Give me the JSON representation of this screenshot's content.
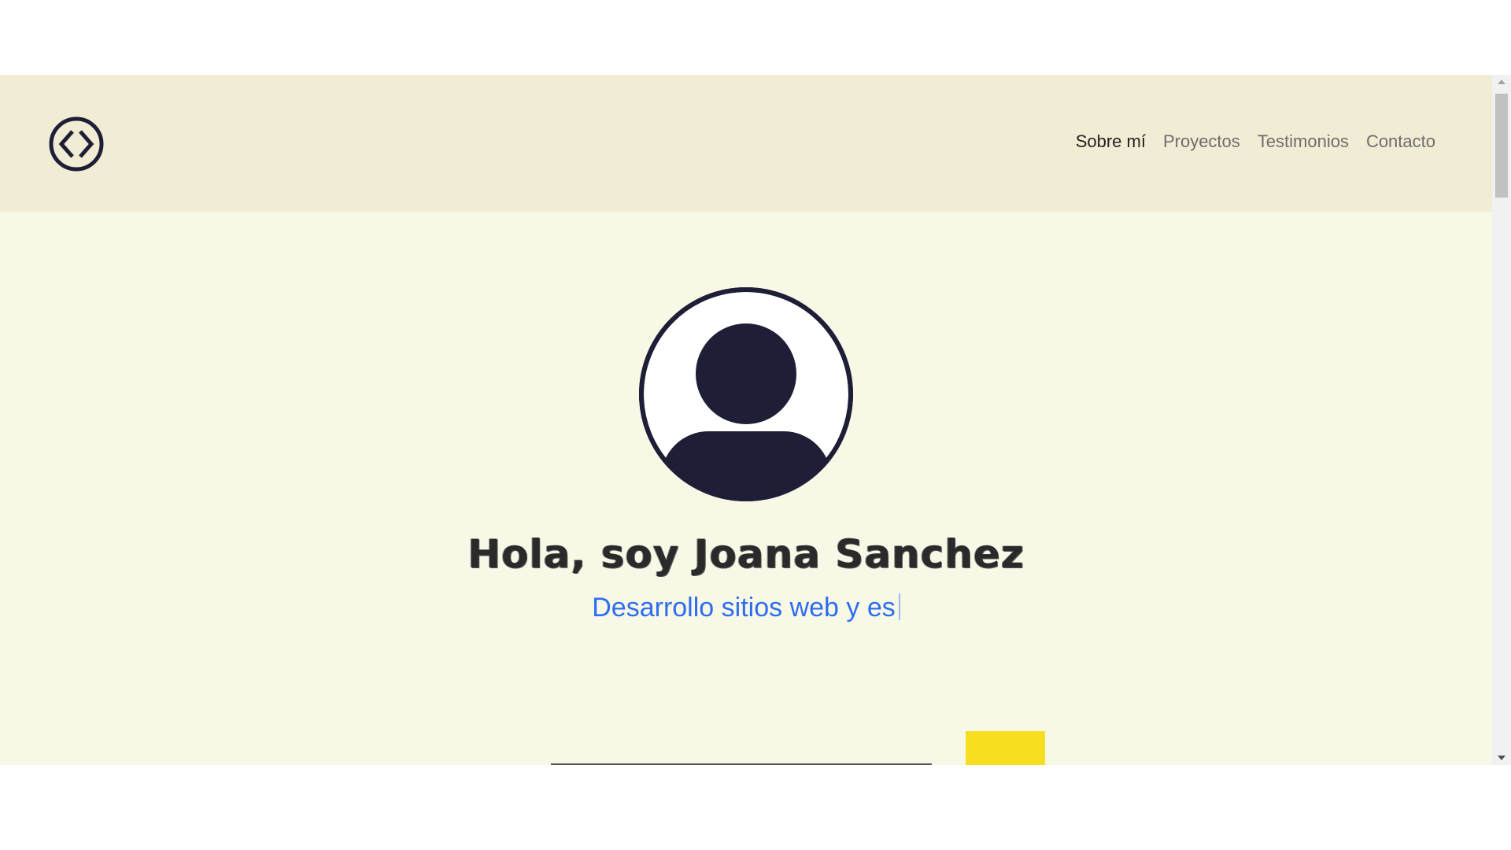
{
  "nav": {
    "logo_icon": "code-brackets-icon",
    "items": [
      {
        "label": "Sobre mí",
        "active": true
      },
      {
        "label": "Proyectos",
        "active": false
      },
      {
        "label": "Testimonios",
        "active": false
      },
      {
        "label": "Contacto",
        "active": false
      }
    ]
  },
  "hero": {
    "avatar_icon": "user-avatar-icon",
    "title": "Hola, soy Joana Sanchez",
    "subtitle": "Desarrollo sitios web y es"
  },
  "colors": {
    "navbar_bg": "#f1ecd4",
    "page_bg": "#f8f8e6",
    "subtitle": "#2f6df0",
    "accent_yellow": "#f7de1f",
    "dark": "#1e1e36"
  }
}
